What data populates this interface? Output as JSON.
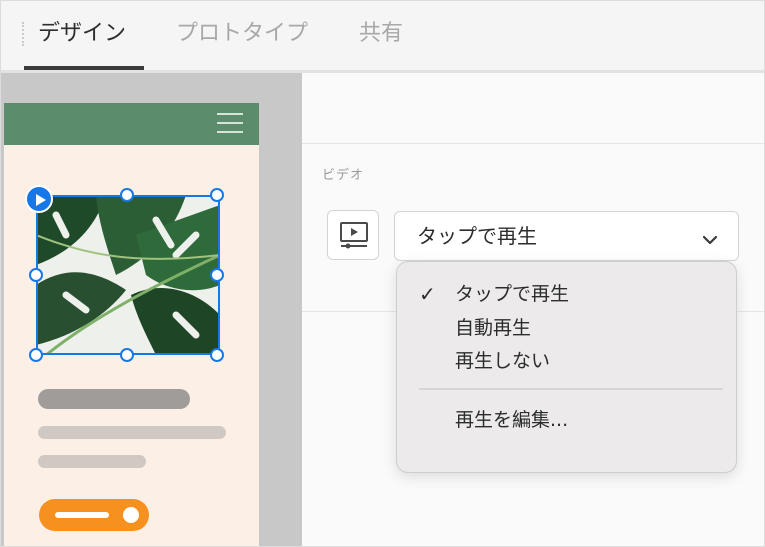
{
  "tabs": [
    {
      "label": "デザイン",
      "active": true
    },
    {
      "label": "プロトタイプ",
      "active": false
    },
    {
      "label": "共有",
      "active": false
    }
  ],
  "panel": {
    "section_label": "ビデオ",
    "video_icon": "video-player-icon",
    "select": {
      "value": "タップで再生",
      "chevron_icon": "chevron-down-icon"
    }
  },
  "menu": {
    "items": [
      {
        "label": "タップで再生",
        "checked": true,
        "check_glyph": "✓"
      },
      {
        "label": "自動再生",
        "checked": false
      },
      {
        "label": "再生しない",
        "checked": false
      }
    ],
    "edit_label": "再生を編集..."
  },
  "artboard": {
    "header_color": "#5b8c6c",
    "background": "#fbefe6",
    "selection_color": "#1877e8",
    "button_color": "#f6901e",
    "menu_icon": "hamburger-icon",
    "play_icon": "play-icon"
  }
}
